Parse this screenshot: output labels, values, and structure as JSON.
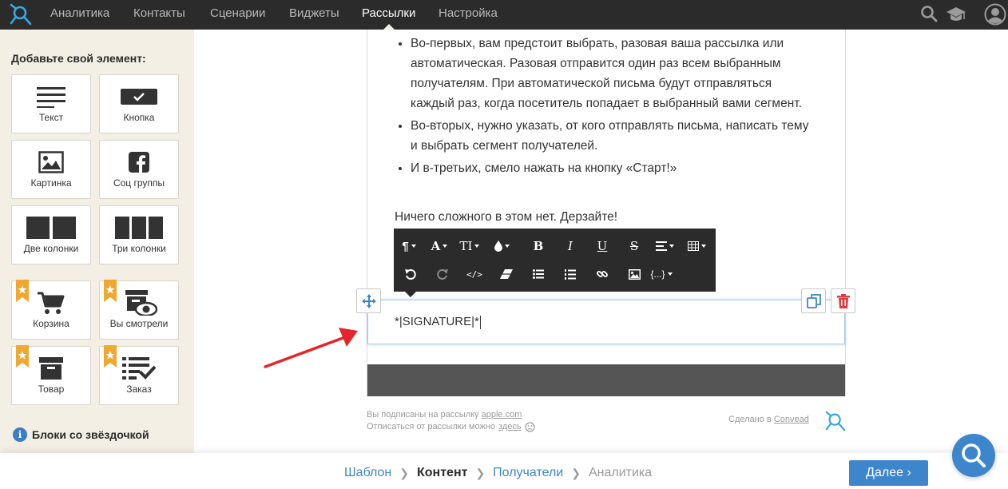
{
  "topnav": {
    "items": [
      "Аналитика",
      "Контакты",
      "Сценарии",
      "Виджеты",
      "Рассылки",
      "Настройка"
    ],
    "active": "Рассылки"
  },
  "sidebar": {
    "title": "Добавьте свой элемент:",
    "tiles": [
      {
        "label": "Текст",
        "icon": "text-lines-icon",
        "premium": false
      },
      {
        "label": "Кнопка",
        "icon": "button-icon",
        "premium": false
      },
      {
        "label": "Картинка",
        "icon": "image-icon",
        "premium": false
      },
      {
        "label": "Соц группы",
        "icon": "facebook-icon",
        "premium": false
      },
      {
        "label": "Две колонки",
        "icon": "two-columns-icon",
        "premium": false
      },
      {
        "label": "Три колонки",
        "icon": "three-columns-icon",
        "premium": false
      },
      {
        "label": "Корзина",
        "icon": "cart-icon",
        "premium": true
      },
      {
        "label": "Вы смотрели",
        "icon": "viewed-icon",
        "premium": true
      },
      {
        "label": "Товар",
        "icon": "product-box-icon",
        "premium": true
      },
      {
        "label": "Заказ",
        "icon": "order-list-icon",
        "premium": true
      }
    ],
    "info": "Блоки со звёздочкой"
  },
  "email": {
    "bullets": [
      "Во-первых, вам предстоит выбрать, разовая ваша рассылка или автоматическая. Разовая отправится один раз всем выбранным получателям. При автоматической письма будут отправляться каждый раз, когда посетитель попадает в выбранный вами сегмент.",
      "Во-вторых, нужно указать, от кого отправлять письма, написать тему и выбрать сегмент получателей.",
      "И в-третьих, смело нажать на кнопку «Старт!»"
    ],
    "outro": "Ничего сложного в этом нет. Дерзайте!",
    "signature": "*|SIGNATURE|*"
  },
  "toolbar": {
    "row1": [
      "¶",
      "A",
      "TI",
      "",
      "B",
      "I",
      "U",
      "S",
      "",
      ""
    ],
    "row2": [
      "",
      "",
      "</>",
      "",
      "",
      "",
      "",
      "",
      "{...}"
    ],
    "labels": {
      "paragraph": "¶",
      "font": "A",
      "size": "TI",
      "bold": "B",
      "italic": "I",
      "underline": "U",
      "strike": "S",
      "code": "</>",
      "vars": "{...}"
    }
  },
  "meta": {
    "subscribed_prefix": "Вы подписаны на рассылку",
    "subscribed_link": "apple.com",
    "unsub_prefix": "Отписаться от рассылки можно",
    "unsub_link": "здесь",
    "made_prefix": "Сделано в",
    "made_link": "Convead"
  },
  "bottom": {
    "steps": [
      "Шаблон",
      "Контент",
      "Получатели",
      "Аналитика"
    ],
    "next": "Далее"
  },
  "colors": {
    "accent": "#3d86cc",
    "dark": "#2b2b2b",
    "sidebar": "#f3efe4",
    "delete": "#e23b3b",
    "arrow": "#e4262b"
  }
}
